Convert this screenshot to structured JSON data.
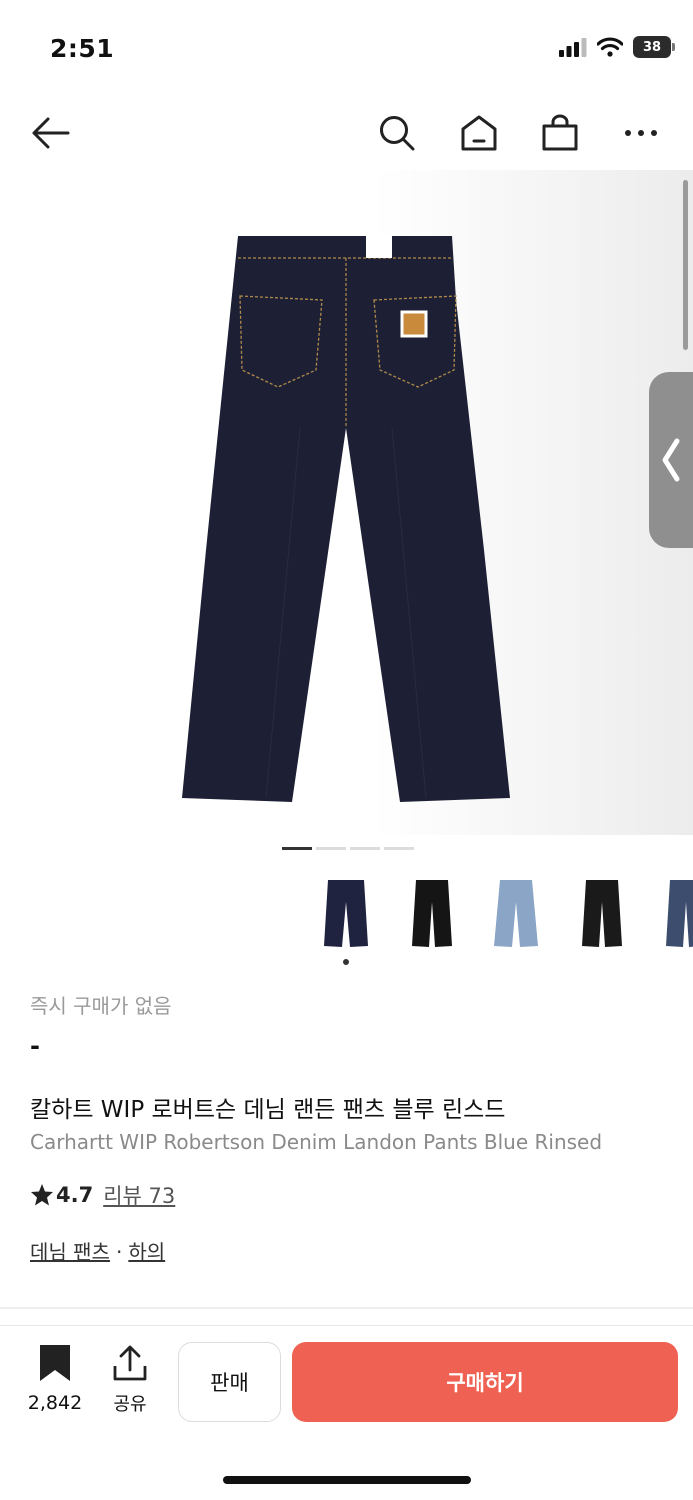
{
  "status": {
    "time": "2:51",
    "battery": "38"
  },
  "product": {
    "instant_buy_label": "즉시 구매가 없음",
    "price": "-",
    "title_ko": "칼하트 WIP 로버트슨 데님 랜든 팬츠 블루 린스드",
    "title_en": "Carhartt WIP Robertson Denim Landon Pants Blue Rinsed",
    "rating": "4.7",
    "review_label": "리뷰 73",
    "category_primary": "데님 팬츠",
    "category_separator": "·",
    "category_secondary": "하의"
  },
  "thumbnails": [
    {
      "name": "blue-rinsed",
      "color": "#1f2340"
    },
    {
      "name": "black",
      "color": "#151515"
    },
    {
      "name": "light-blue",
      "color": "#8ba5c7"
    },
    {
      "name": "black-2",
      "color": "#1a1a1a"
    },
    {
      "name": "navy",
      "color": "#3d4d6e"
    }
  ],
  "gallery": {
    "page_count": 4,
    "active_page": 1
  },
  "bottom_bar": {
    "bookmark_count": "2,842",
    "share_label": "공유",
    "sell_label": "판매",
    "buy_label": "구매하기"
  },
  "colors": {
    "accent": "#ef6253",
    "product_denim": "#1d2034",
    "stitch": "#b08a4a"
  }
}
